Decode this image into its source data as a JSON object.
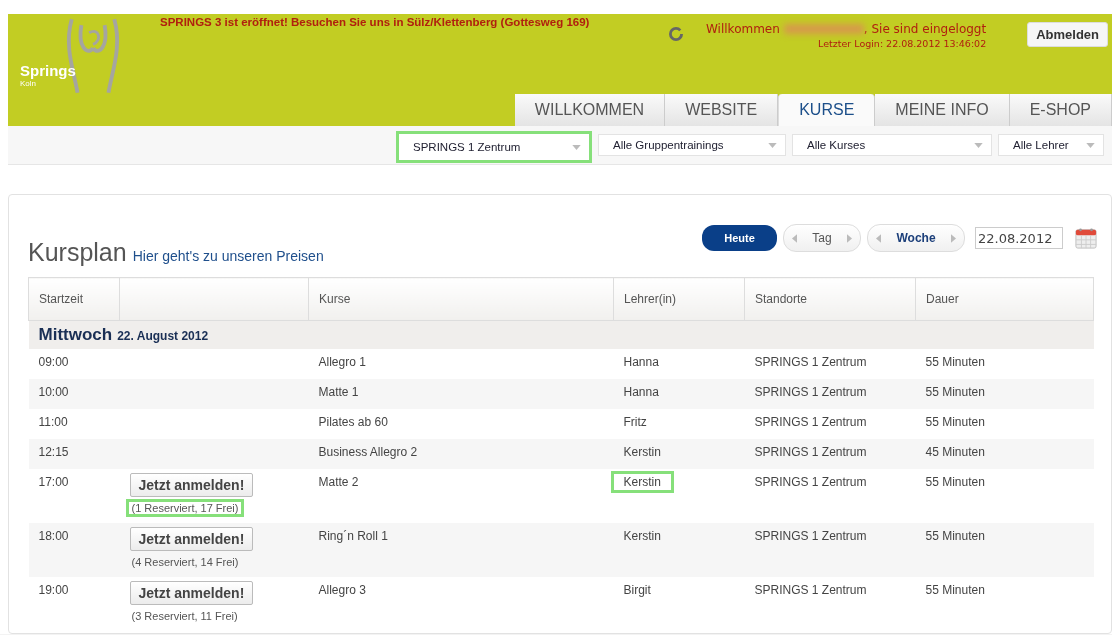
{
  "header": {
    "logo": {
      "name": "Springs",
      "city": "Koln"
    },
    "announcement": "SPRINGS 3 ist eröffnet! Besuchen Sie uns in Sülz/Klettenberg (Gottesweg 169)",
    "welcome": {
      "greeting": "Willkommen",
      "suffix": ", Sie sind eingeloggt",
      "last_login": "Letzter Login: 22.08.2012 13:46:02",
      "name_redacted": true
    },
    "logout_button": "Abmelden"
  },
  "tabs": [
    {
      "label": "WILLKOMMEN",
      "selected": false
    },
    {
      "label": "WEBSITE",
      "selected": false
    },
    {
      "label": "KURSE",
      "selected": true
    },
    {
      "label": "MEINE INFO",
      "selected": false
    },
    {
      "label": "E-SHOP",
      "selected": false
    }
  ],
  "filters": [
    {
      "value": "SPRINGS 1 Zentrum",
      "highlighted": true
    },
    {
      "value": "Alle Gruppentrainings",
      "highlighted": false
    },
    {
      "value": "Alle Kurses",
      "highlighted": false
    },
    {
      "value": "Alle Lehrer",
      "highlighted": false
    }
  ],
  "title": "Kursplan",
  "price_link": "Hier geht's zu unseren Preisen",
  "nav": {
    "today": "Heute",
    "day": "Tag",
    "week": "Woche",
    "date": "22.08.2012"
  },
  "table": {
    "columns": [
      "Startzeit",
      "",
      "Kurse",
      "Lehrer(in)",
      "Standorte",
      "Dauer"
    ],
    "day": {
      "weekday": "Mittwoch",
      "date": "22. August 2012"
    },
    "rows": [
      {
        "time": "09:00",
        "course": "Allegro 1",
        "teacher": "Hanna",
        "location": "SPRINGS 1 Zentrum",
        "duration": "55 Minuten"
      },
      {
        "time": "10:00",
        "course": "Matte 1",
        "teacher": "Hanna",
        "location": "SPRINGS 1 Zentrum",
        "duration": "55 Minuten"
      },
      {
        "time": "11:00",
        "course": "Pilates ab 60",
        "teacher": "Fritz",
        "location": "SPRINGS 1 Zentrum",
        "duration": "55 Minuten"
      },
      {
        "time": "12:15",
        "course": "Business Allegro 2",
        "teacher": "Kerstin",
        "location": "SPRINGS 1 Zentrum",
        "duration": "45 Minuten"
      },
      {
        "time": "17:00",
        "signup": "Jetzt anmelden!",
        "availability": "(1 Reserviert, 17 Frei)",
        "availability_highlighted": true,
        "course": "Matte 2",
        "teacher": "Kerstin",
        "teacher_highlighted": true,
        "location": "SPRINGS 1 Zentrum",
        "duration": "55 Minuten"
      },
      {
        "time": "18:00",
        "signup": "Jetzt anmelden!",
        "availability": "(4 Reserviert, 14 Frei)",
        "availability_highlighted": false,
        "course": "Ring´n Roll 1",
        "teacher": "Kerstin",
        "teacher_highlighted": false,
        "location": "SPRINGS 1 Zentrum",
        "duration": "55 Minuten"
      },
      {
        "time": "19:00",
        "signup": "Jetzt anmelden!",
        "availability": "(3 Reserviert, 11 Frei)",
        "availability_highlighted": false,
        "course": "Allegro 3",
        "teacher": "Birgit",
        "teacher_highlighted": false,
        "location": "SPRINGS 1 Zentrum",
        "duration": "55 Minuten"
      }
    ]
  }
}
